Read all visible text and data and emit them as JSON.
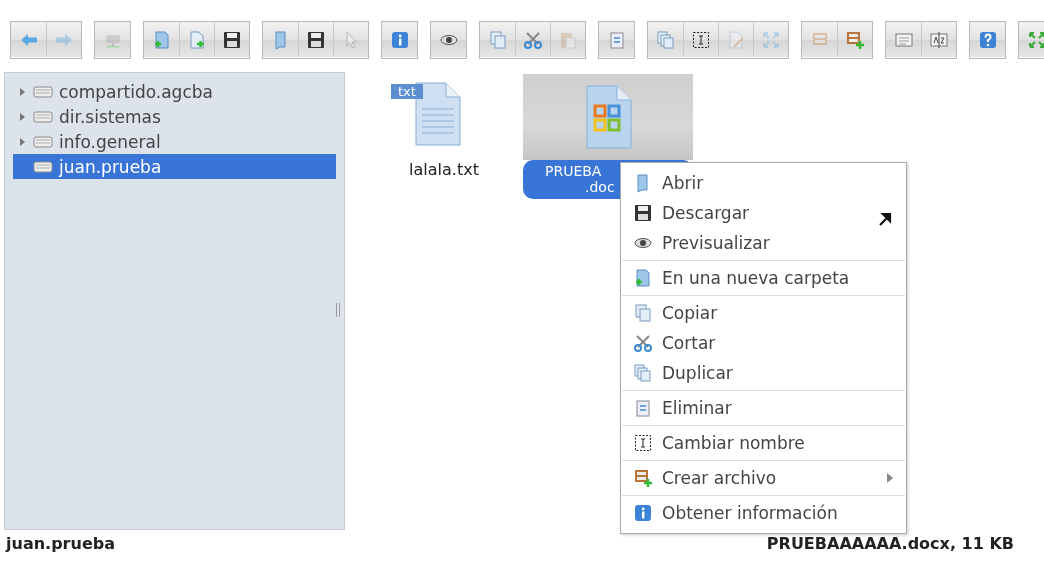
{
  "toolbar": {
    "groups": [
      {
        "buttons": [
          {
            "disabled": false
          },
          {
            "disabled": true
          }
        ]
      },
      {
        "buttons": [
          {
            "disabled": true
          }
        ]
      },
      {
        "buttons": [
          {
            "disabled": false
          },
          {
            "disabled": false
          },
          {
            "disabled": false
          }
        ]
      },
      {
        "buttons": [
          {
            "disabled": false
          },
          {
            "disabled": false
          },
          {
            "disabled": true
          }
        ]
      },
      {
        "buttons": [
          {
            "disabled": false
          }
        ]
      },
      {
        "buttons": [
          {
            "disabled": false
          }
        ]
      },
      {
        "buttons": [
          {
            "disabled": false
          },
          {
            "disabled": false
          },
          {
            "disabled": true
          }
        ]
      },
      {
        "buttons": [
          {
            "disabled": false
          }
        ]
      },
      {
        "buttons": [
          {
            "disabled": false
          },
          {
            "disabled": false
          },
          {
            "disabled": true
          },
          {
            "disabled": true
          }
        ]
      },
      {
        "buttons": [
          {
            "disabled": true
          },
          {
            "disabled": false
          }
        ]
      },
      {
        "buttons": [
          {
            "disabled": false
          },
          {
            "disabled": false
          }
        ]
      },
      {
        "buttons": [
          {
            "disabled": false
          }
        ]
      },
      {
        "buttons": [
          {
            "disabled": false
          }
        ]
      }
    ]
  },
  "sidebar": {
    "items": [
      {
        "label": "compartido.agcba",
        "expandable": true,
        "selected": false
      },
      {
        "label": "dir.sistemas",
        "expandable": true,
        "selected": false
      },
      {
        "label": "info.general",
        "expandable": true,
        "selected": false
      },
      {
        "label": "juan.prueba",
        "expandable": false,
        "selected": true
      }
    ]
  },
  "files": [
    {
      "kind": "txt",
      "badge": "txt",
      "name_lines": [
        "lalala.txt"
      ],
      "selected": false
    },
    {
      "kind": "doc",
      "name_lines": [
        "PRUEBA",
        ".doc"
      ],
      "selected": true
    }
  ],
  "context_menu": {
    "groups": [
      {
        "items": [
          {
            "label": "Abrir",
            "submenu": false
          },
          {
            "label": "Descargar",
            "submenu": false
          },
          {
            "label": "Previsualizar",
            "submenu": false
          }
        ]
      },
      {
        "items": [
          {
            "label": "En una nueva carpeta",
            "submenu": false
          }
        ]
      },
      {
        "items": [
          {
            "label": "Copiar",
            "submenu": false
          },
          {
            "label": "Cortar",
            "submenu": false
          },
          {
            "label": "Duplicar",
            "submenu": false
          }
        ]
      },
      {
        "items": [
          {
            "label": "Eliminar",
            "submenu": false
          }
        ]
      },
      {
        "items": [
          {
            "label": "Cambiar nombre",
            "submenu": false
          }
        ]
      },
      {
        "items": [
          {
            "label": "Crear archivo",
            "submenu": true
          }
        ]
      },
      {
        "items": [
          {
            "label": "Obtener información",
            "submenu": false
          }
        ]
      }
    ]
  },
  "status_bar": {
    "path": "juan.prueba",
    "selection": "PRUEBAAAAAA.docx, 11 KB"
  }
}
